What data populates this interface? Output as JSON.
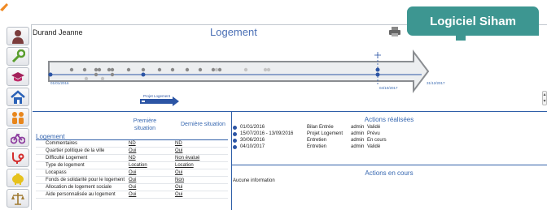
{
  "app": {
    "badge": "Logiciel Siham"
  },
  "header": {
    "person_name": "Durand Jeanne",
    "page_title": "Logement"
  },
  "sidebar": {
    "items": [
      {
        "icon": "person-icon"
      },
      {
        "icon": "wrench-icon"
      },
      {
        "icon": "graduation-cap-icon"
      },
      {
        "icon": "house-icon"
      },
      {
        "icon": "family-icon"
      },
      {
        "icon": "bicycle-icon"
      },
      {
        "icon": "stethoscope-icon"
      },
      {
        "icon": "piggy-bank-icon"
      },
      {
        "icon": "scales-icon"
      }
    ]
  },
  "timeline": {
    "start_date": "01/01/2016",
    "mid_date": "04/10/2017",
    "end_date": "31/12/2017",
    "event_label": "Projet Logement"
  },
  "logement": {
    "section_title": "Logement",
    "col_first": "Première situation",
    "col_current": "Dernière situation",
    "rows": [
      {
        "label": "Commentaires",
        "first": "ND",
        "current": "ND"
      },
      {
        "label": "Quartier politique de la ville",
        "first": "Oui",
        "current": "Oui"
      },
      {
        "label": "Difficulté Logement",
        "first": "ND",
        "current": "Non évalué"
      },
      {
        "label": "Type de logement",
        "first": "Location",
        "current": "Location"
      },
      {
        "label": "Locapass",
        "first": "Oui",
        "current": "Oui"
      },
      {
        "label": "Fonds de solidarité pour le logement",
        "first": "Oui",
        "current": "Non"
      },
      {
        "label": "Allocation de logement sociale",
        "first": "Oui",
        "current": "Oui"
      },
      {
        "label": "Aide personnalisée au logement",
        "first": "Oui",
        "current": "Oui"
      }
    ]
  },
  "actions_realisees": {
    "title": "Actions réalisées",
    "items": [
      {
        "date": "01/01/2016",
        "type": "Bilan Entrée",
        "user": "admin",
        "status": "Validé"
      },
      {
        "date": "15/07/2016 - 13/09/2016",
        "type": "Projet Logement",
        "user": "admin",
        "status": "Prévu"
      },
      {
        "date": "30/06/2016",
        "type": "Entretien",
        "user": "admin",
        "status": "En cours"
      },
      {
        "date": "04/10/2017",
        "type": "Entretien",
        "user": "admin",
        "status": "Validé"
      }
    ]
  },
  "actions_en_cours": {
    "title": "Actions en cours",
    "empty": "Aucune information"
  },
  "colors": {
    "accent": "#3d9691",
    "link": "#3667b0",
    "divider": "#2f5fa8",
    "event_bar": "#2c55a5"
  }
}
